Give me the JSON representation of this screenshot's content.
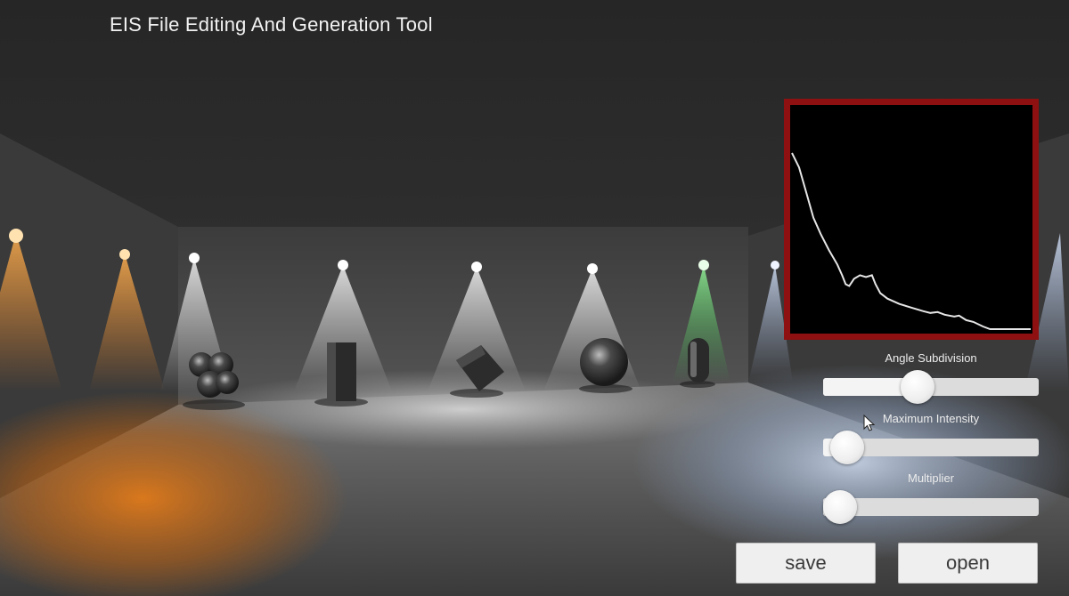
{
  "app": {
    "title": "EIS File Editing And Generation Tool"
  },
  "curve": {
    "border_color": "#8e1010",
    "background": "#000000",
    "line_color": "#e6e6e6",
    "points": [
      [
        0,
        0.98
      ],
      [
        0.03,
        0.9
      ],
      [
        0.06,
        0.76
      ],
      [
        0.09,
        0.62
      ],
      [
        0.12,
        0.53
      ],
      [
        0.155,
        0.44
      ],
      [
        0.19,
        0.36
      ],
      [
        0.21,
        0.3
      ],
      [
        0.225,
        0.25
      ],
      [
        0.24,
        0.24
      ],
      [
        0.26,
        0.28
      ],
      [
        0.285,
        0.3
      ],
      [
        0.31,
        0.29
      ],
      [
        0.335,
        0.3
      ],
      [
        0.35,
        0.25
      ],
      [
        0.37,
        0.2
      ],
      [
        0.4,
        0.17
      ],
      [
        0.45,
        0.14
      ],
      [
        0.5,
        0.12
      ],
      [
        0.55,
        0.1
      ],
      [
        0.58,
        0.09
      ],
      [
        0.61,
        0.095
      ],
      [
        0.64,
        0.08
      ],
      [
        0.68,
        0.07
      ],
      [
        0.7,
        0.075
      ],
      [
        0.73,
        0.05
      ],
      [
        0.76,
        0.04
      ],
      [
        0.8,
        0.015
      ],
      [
        0.83,
        0.0
      ],
      [
        1.0,
        0.0
      ]
    ]
  },
  "sliders": [
    {
      "label": "Angle Subdivision",
      "value": 0.44
    },
    {
      "label": "Maximum Intensity",
      "value": 0.11
    },
    {
      "label": "Multiplier",
      "value": 0.02
    }
  ],
  "buttons": {
    "save": "save",
    "open": "open"
  }
}
